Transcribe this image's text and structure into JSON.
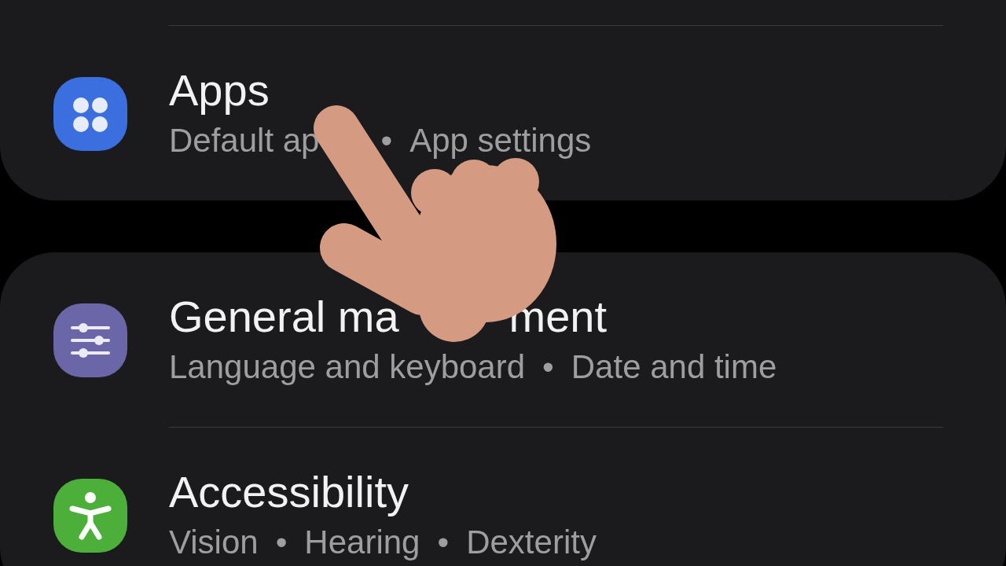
{
  "cards": [
    {
      "top_cut": true,
      "items": [
        {
          "color": "#3b6fe0",
          "title": [
            {
              "text": "Apps",
              "kind": "whole"
            }
          ],
          "separator": "•",
          "subtitle": [
            {
              "text": "Default ap",
              "kind": "cut"
            },
            {
              "text": "App settings",
              "kind": "whole"
            }
          ]
        }
      ]
    },
    {
      "top_cut": false,
      "items": [
        {
          "color": "#6b66a8",
          "title": [
            {
              "text": "General ma",
              "kind": "cut"
            },
            {
              "text": "ment",
              "kind": "whole"
            }
          ],
          "separator": "•",
          "subtitle": [
            {
              "text": "Language and keyboard",
              "kind": "whole"
            },
            {
              "text": "Date and time",
              "kind": "whole"
            }
          ]
        },
        {
          "color": "#4caf3a",
          "title": [
            {
              "text": "Accessibility",
              "kind": "whole"
            }
          ],
          "separator": "•",
          "subtitle": [
            {
              "text": "Vision",
              "kind": "whole"
            },
            {
              "text": "Hearing",
              "kind": "whole"
            },
            {
              "text": "Dexterity",
              "kind": "whole"
            }
          ]
        }
      ]
    }
  ],
  "pointer": {
    "kind": "hand"
  }
}
